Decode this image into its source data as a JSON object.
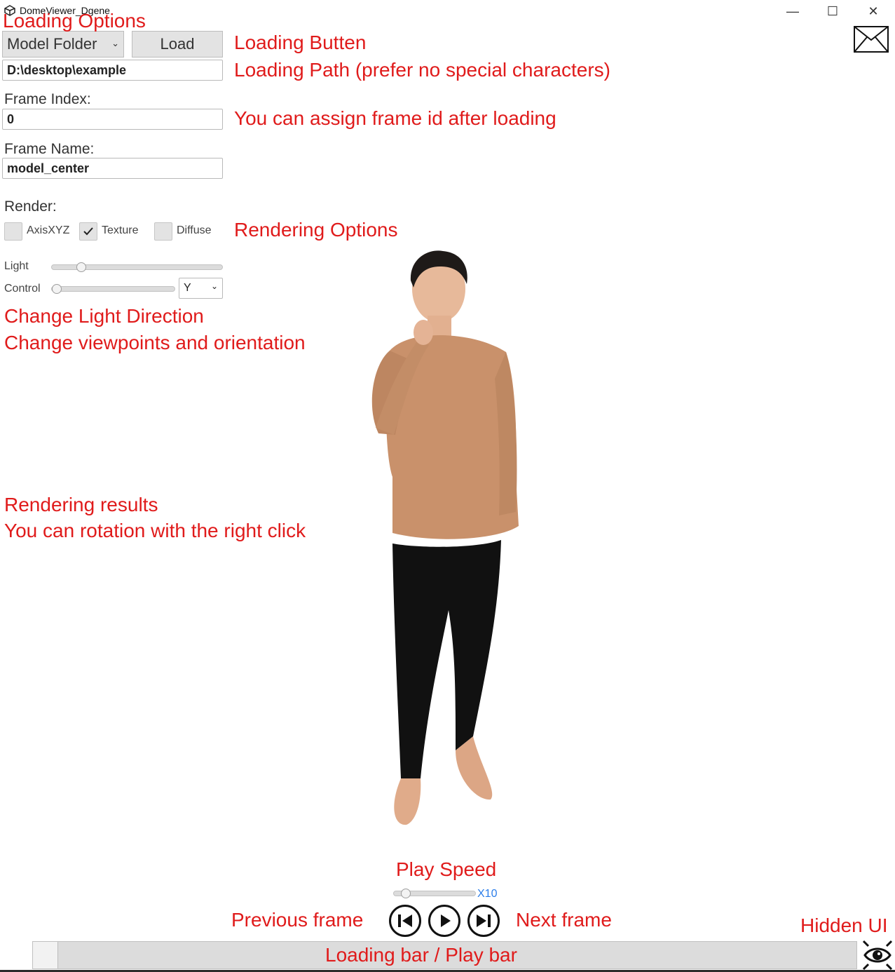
{
  "window": {
    "title": "DomeViewer_Dgene",
    "minimize_glyph": "—",
    "maximize_glyph": "☐",
    "close_glyph": "✕"
  },
  "loading": {
    "mode_value": "Model Folder",
    "load_label": "Load",
    "path_value": "D:\\desktop\\example"
  },
  "frame": {
    "index_label": "Frame Index:",
    "index_value": "0",
    "name_label": "Frame Name:",
    "name_value": "model_center"
  },
  "render": {
    "label": "Render:",
    "options": [
      {
        "label": "AxisXYZ",
        "checked": false
      },
      {
        "label": "Texture",
        "checked": true
      },
      {
        "label": "Diffuse",
        "checked": false
      }
    ],
    "light_label": "Light",
    "light_value": 0.15,
    "control_label": "Control",
    "control_value": 0.0,
    "axis_value": "Y"
  },
  "playback": {
    "speed_value": 0.1,
    "speed_text": "X10",
    "progress": 0.0
  },
  "annotations": {
    "loading_options": "Loading Options",
    "loading_button": "Loading Butten",
    "loading_path": "Loading Path (prefer no special characters)",
    "frame_id": "You can assign frame id after loading",
    "rendering_options": "Rendering Options",
    "light_direction": "Change Light Direction",
    "viewpoints": "Change viewpoints and orientation",
    "rendering_results": "Rendering results",
    "rotation": "You can rotation with the right click",
    "play_speed": "Play Speed",
    "previous_frame": "Previous frame",
    "next_frame": "Next frame",
    "hidden_ui": "Hidden UI",
    "play_bar": "Loading bar / Play bar"
  },
  "icons": {
    "app": "unity-icon",
    "mail": "envelope-icon",
    "eye": "eye-icon"
  },
  "colors": {
    "annotation": "#e01b1b",
    "speed_text": "#2b7de9"
  }
}
